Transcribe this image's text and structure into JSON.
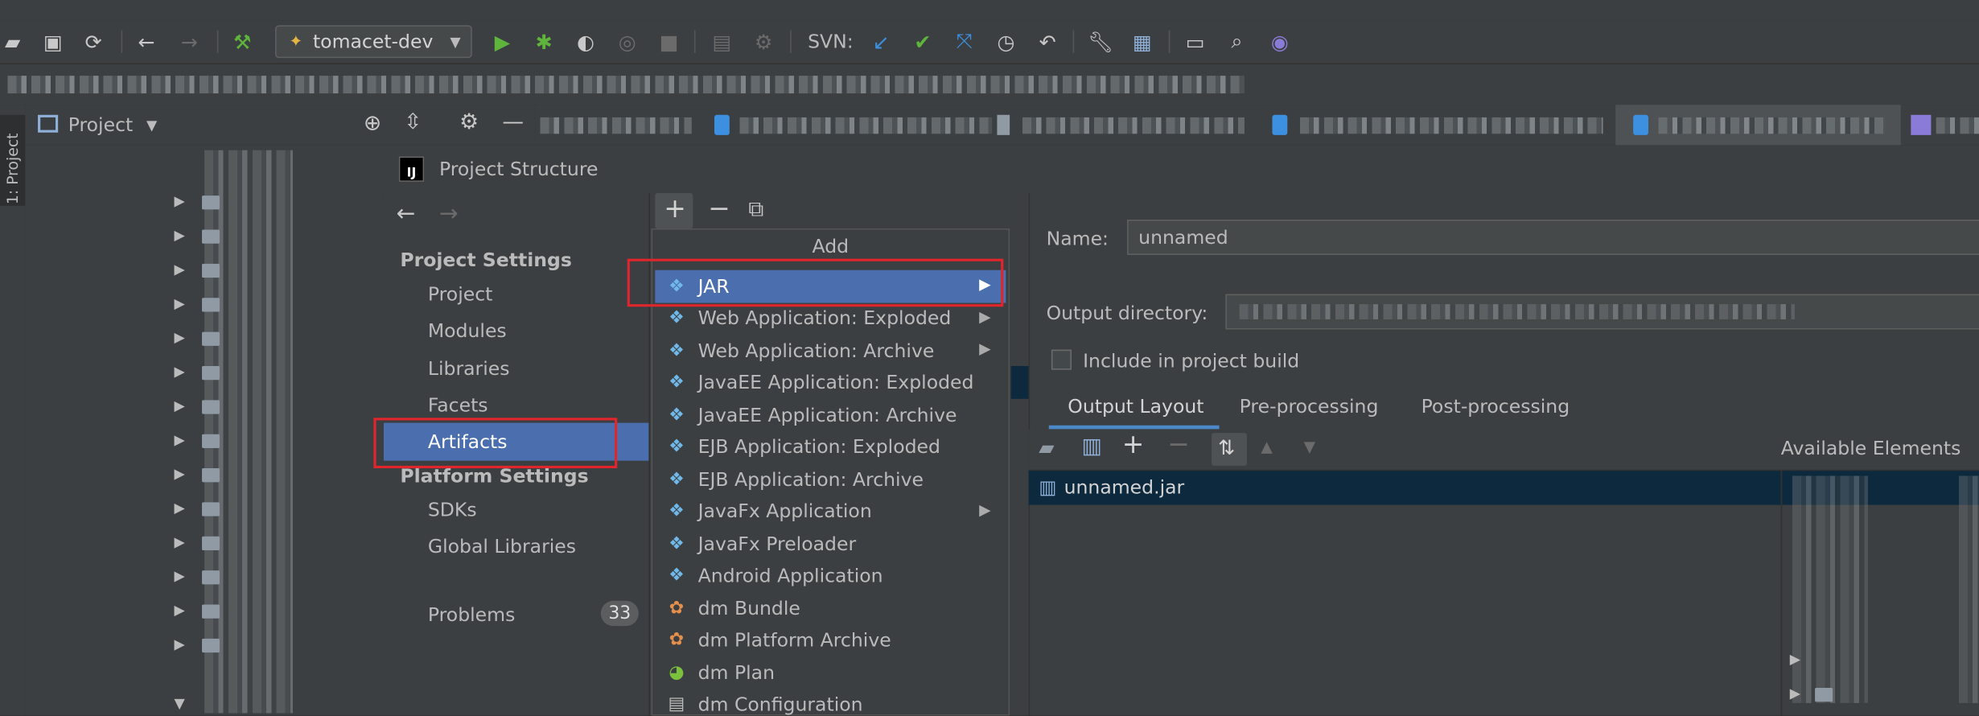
{
  "toolbar": {
    "run_config": "tomacet-dev",
    "svn_label": "SVN:",
    "icons": [
      "folder-open-icon",
      "save-icon",
      "sync-icon",
      "back-icon",
      "forward-icon",
      "build-hammer-icon",
      "run-icon",
      "debug-icon",
      "coverage-icon",
      "profile-icon",
      "stop-icon",
      "svn-update-icon",
      "svn-commit-icon",
      "svn-compare-icon",
      "history-icon",
      "revert-icon",
      "settings-wrench-icon",
      "project-structure-icon",
      "terminal-icon",
      "search-icon",
      "plugin-icon"
    ]
  },
  "tool_window": {
    "side_tab_label": "1: Project",
    "header_label": "Project"
  },
  "dialog": {
    "title": "Project Structure",
    "project_settings_header": "Project Settings",
    "project_settings_items": [
      "Project",
      "Modules",
      "Libraries",
      "Facets",
      "Artifacts"
    ],
    "platform_settings_header": "Platform Settings",
    "platform_settings_items": [
      "SDKs",
      "Global Libraries"
    ],
    "problems_label": "Problems",
    "problems_count": "33",
    "selected_item": "Artifacts"
  },
  "add_popup": {
    "title": "Add",
    "items": [
      {
        "label": "JAR",
        "submenu": true,
        "selected": true
      },
      {
        "label": "Web Application: Exploded",
        "submenu": true
      },
      {
        "label": "Web Application: Archive",
        "submenu": true
      },
      {
        "label": "JavaEE Application: Exploded",
        "submenu": false
      },
      {
        "label": "JavaEE Application: Archive",
        "submenu": false
      },
      {
        "label": "EJB Application: Exploded",
        "submenu": false
      },
      {
        "label": "EJB Application: Archive",
        "submenu": false
      },
      {
        "label": "JavaFx Application",
        "submenu": true
      },
      {
        "label": "JavaFx Preloader",
        "submenu": false
      },
      {
        "label": "Android Application",
        "submenu": false
      },
      {
        "label": "dm Bundle",
        "submenu": false
      },
      {
        "label": "dm Platform Archive",
        "submenu": false
      },
      {
        "label": "dm Plan",
        "submenu": false
      },
      {
        "label": "dm Configuration",
        "submenu": false
      }
    ]
  },
  "artifact": {
    "name_label": "Name:",
    "name_value": "unnamed",
    "output_dir_label": "Output directory:",
    "include_label": "Include in project build",
    "tabs": [
      "Output Layout",
      "Pre-processing",
      "Post-processing"
    ],
    "active_tab": "Output Layout",
    "available_elements_label": "Available Elements",
    "output_item": "unnamed.jar"
  },
  "colors": {
    "background": "#3c3f41",
    "selection": "#4b6eaf",
    "highlight_box": "#e0262c",
    "tab_underline": "#4a88c7"
  }
}
